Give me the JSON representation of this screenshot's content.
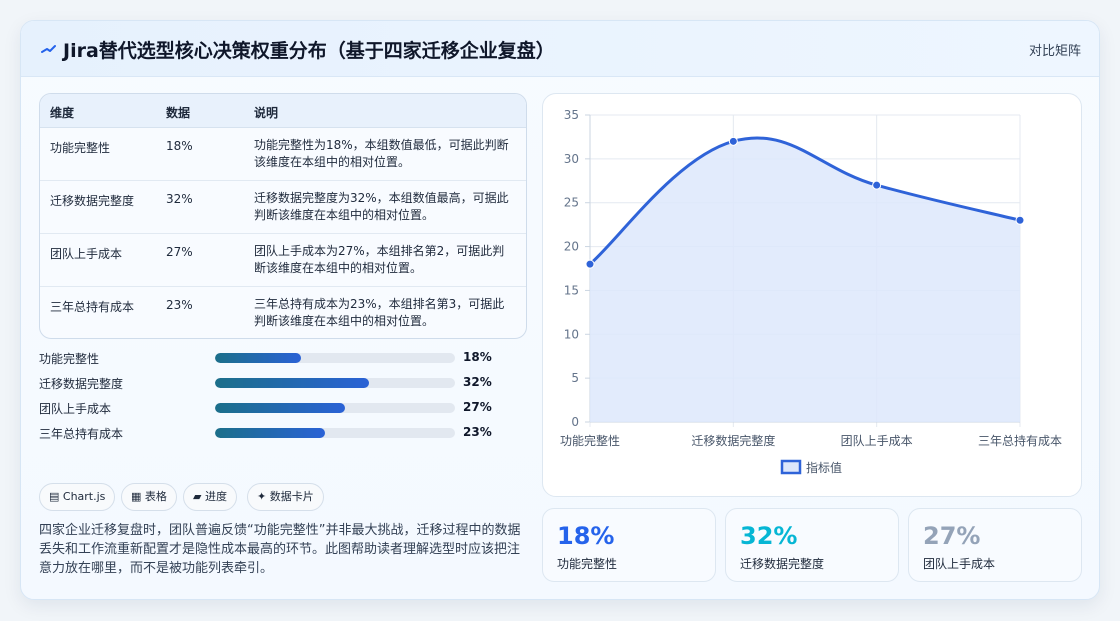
{
  "header": {
    "title": "Jira替代选型核心决策权重分布（基于四家迁移企业复盘）",
    "link": "对比矩阵"
  },
  "table": {
    "headers": [
      "维度",
      "数据",
      "说明"
    ],
    "rows": [
      {
        "dim": "功能完整性",
        "value": "18%",
        "note": "功能完整性为18%，本组数值最低，可据此判断该维度在本组中的相对位置。"
      },
      {
        "dim": "迁移数据完整度",
        "value": "32%",
        "note": "迁移数据完整度为32%，本组数值最高，可据此判断该维度在本组中的相对位置。"
      },
      {
        "dim": "团队上手成本",
        "value": "27%",
        "note": "团队上手成本为27%，本组排名第2，可据此判断该维度在本组中的相对位置。"
      },
      {
        "dim": "三年总持有成本",
        "value": "23%",
        "note": "三年总持有成本为23%，本组排名第3，可据此判断该维度在本组中的相对位置。"
      }
    ]
  },
  "progress": [
    {
      "label": "功能完整性",
      "value": 18,
      "text": "18%"
    },
    {
      "label": "迁移数据完整度",
      "value": 32,
      "text": "32%"
    },
    {
      "label": "团队上手成本",
      "value": 27,
      "text": "27%"
    },
    {
      "label": "三年总持有成本",
      "value": 23,
      "text": "23%"
    }
  ],
  "chips": [
    "▤ Chart.js",
    "▦ 表格",
    "▰ 进度",
    "✦ 数据卡片"
  ],
  "description": "四家企业迁移复盘时，团队普遍反馈“功能完整性”并非最大挑战，迁移过程中的数据丢失和工作流重新配置才是隐性成本最高的环节。此图帮助读者理解选型时应该把注意力放在哪里，而不是被功能列表牵引。",
  "stats": [
    {
      "value": "18%",
      "label": "功能完整性",
      "color": "#2563eb"
    },
    {
      "value": "32%",
      "label": "迁移数据完整度",
      "color": "#06b6d4"
    },
    {
      "value": "27%",
      "label": "团队上手成本",
      "color": "#94a3b8"
    }
  ],
  "chart_data": {
    "type": "area",
    "categories": [
      "功能完整性",
      "迁移数据完整度",
      "团队上手成本",
      "三年总持有成本"
    ],
    "series": [
      {
        "name": "指标值",
        "values": [
          18,
          32,
          27,
          23
        ]
      }
    ],
    "ylim": [
      0,
      35
    ],
    "yticks": [
      0,
      5,
      10,
      15,
      20,
      25,
      30,
      35
    ],
    "grid": true,
    "legend": "bottom",
    "line_color": "#2f63d8",
    "fill_color": "#dde7fb"
  }
}
